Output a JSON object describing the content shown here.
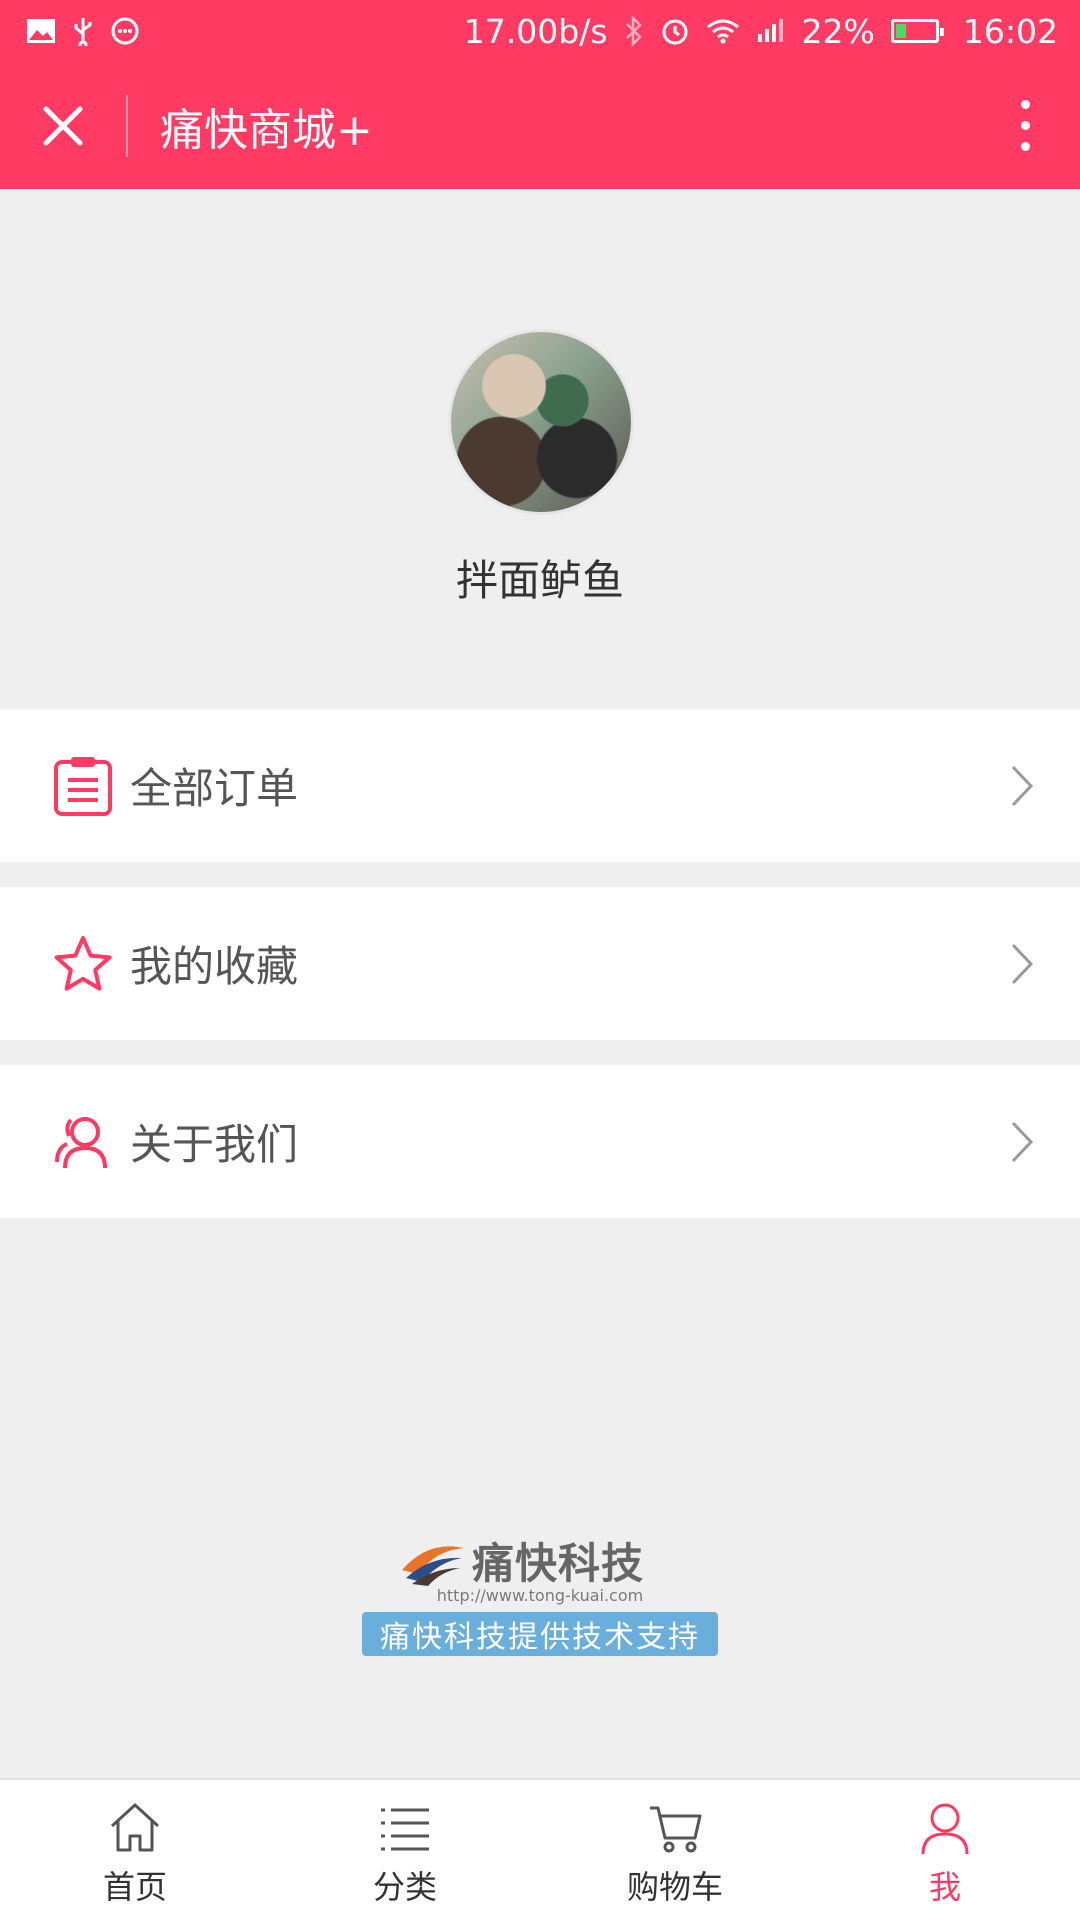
{
  "status_bar": {
    "net_speed": "17.00b/s",
    "battery": "22%",
    "time": "16:02",
    "icons": [
      "image-icon",
      "usb-icon",
      "chat-icon",
      "bluetooth-icon",
      "alarm-icon",
      "wifi-icon",
      "signal-icon",
      "battery-icon"
    ]
  },
  "header": {
    "title": "痛快商城+",
    "close_icon": "close-icon",
    "more_icon": "more-vertical-icon"
  },
  "profile": {
    "username": "拌面鲈鱼"
  },
  "menu": [
    {
      "label": "全部订单",
      "icon": "order-list-icon"
    },
    {
      "label": "我的收藏",
      "icon": "star-icon"
    },
    {
      "label": "关于我们",
      "icon": "users-icon"
    }
  ],
  "footer": {
    "brand": "痛快科技",
    "url": "http://www.tong-kuai.com",
    "support": "痛快科技提供技术支持"
  },
  "tabs": [
    {
      "label": "首页",
      "icon": "home-icon",
      "active": false
    },
    {
      "label": "分类",
      "icon": "list-icon",
      "active": false
    },
    {
      "label": "购物车",
      "icon": "cart-icon",
      "active": false
    },
    {
      "label": "我",
      "icon": "user-icon",
      "active": true
    }
  ],
  "colors": {
    "accent": "#ff3b63",
    "background": "#efefef",
    "badge": "#6aaedb"
  }
}
